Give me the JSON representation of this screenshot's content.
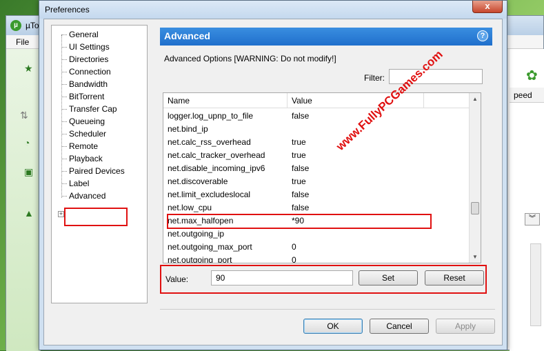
{
  "background_app": {
    "title": "µTo",
    "menu_file": "File",
    "speed_header": "peed"
  },
  "dialog": {
    "title": "Preferences",
    "close_label": "x"
  },
  "tree": {
    "items": [
      "General",
      "UI Settings",
      "Directories",
      "Connection",
      "Bandwidth",
      "BitTorrent",
      "Transfer Cap",
      "Queueing",
      "Scheduler",
      "Remote",
      "Playback",
      "Paired Devices",
      "Label",
      "Advanced"
    ],
    "expander": "+"
  },
  "panel": {
    "header": "Advanced",
    "help": "?",
    "group_label": "Advanced Options [WARNING: Do not modify!]",
    "filter_label": "Filter:",
    "filter_value": ""
  },
  "list": {
    "columns": [
      "Name",
      "Value"
    ],
    "rows": [
      {
        "name": "logger.log_upnp_to_file",
        "value": "false"
      },
      {
        "name": "net.bind_ip",
        "value": ""
      },
      {
        "name": "net.calc_rss_overhead",
        "value": "true"
      },
      {
        "name": "net.calc_tracker_overhead",
        "value": "true"
      },
      {
        "name": "net.disable_incoming_ipv6",
        "value": "false"
      },
      {
        "name": "net.discoverable",
        "value": "true"
      },
      {
        "name": "net.limit_excludeslocal",
        "value": "false"
      },
      {
        "name": "net.low_cpu",
        "value": "false"
      },
      {
        "name": "net.max_halfopen",
        "value": "*90"
      },
      {
        "name": "net.outgoing_ip",
        "value": ""
      },
      {
        "name": "net.outgoing_max_port",
        "value": "0"
      },
      {
        "name": "net.outgoing_port",
        "value": "0"
      }
    ]
  },
  "value_editor": {
    "label": "Value:",
    "value": "90",
    "set_label": "Set",
    "reset_label": "Reset"
  },
  "footer": {
    "ok": "OK",
    "cancel": "Cancel",
    "apply": "Apply"
  },
  "watermark": "www.FullyPCGames.com",
  "colors": {
    "header_blue": "#1f6fcc",
    "highlight_red": "#e01010",
    "utorrent_green": "#3b9a2e"
  }
}
